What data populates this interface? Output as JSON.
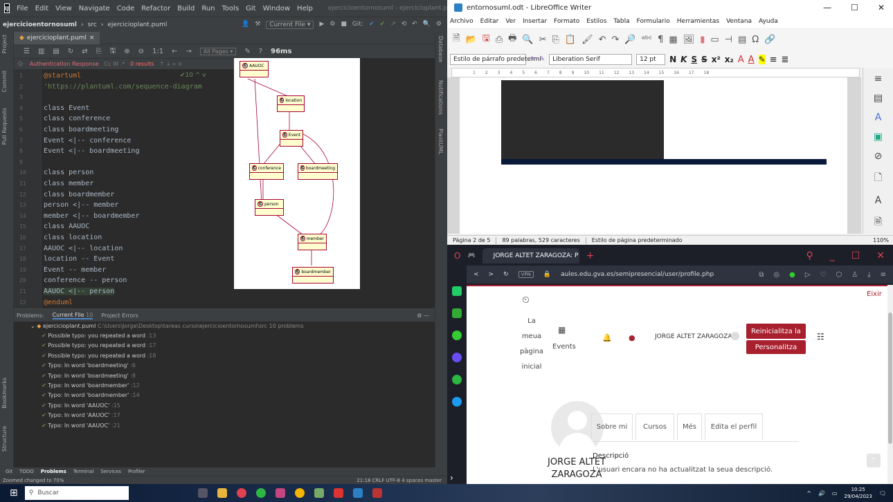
{
  "intellij": {
    "menu": [
      "File",
      "Edit",
      "View",
      "Navigate",
      "Code",
      "Refactor",
      "Build",
      "Run",
      "Tools",
      "Git",
      "Window",
      "Help"
    ],
    "window_title": "ejercicioentornosuml - ejercicioplant.puml",
    "project": "ejercicioentornosuml",
    "src": "src",
    "file": "ejercicioplant.puml",
    "current_file": "Current File ▾",
    "git_label": "Git:",
    "tab": "ejercicioplant.puml",
    "all_pages": "All Pages ▾",
    "zoom_time": "96ms",
    "ratio": "1:1",
    "search_text": "Authentication Response",
    "search_case": "Cc W .*",
    "search_results": "0 results",
    "inspect_count": "✔10 ^ v",
    "code_lines": [
      {
        "n": "1",
        "t": "@startuml",
        "cls": "kw"
      },
      {
        "n": "2",
        "t": "'https://plantuml.com/sequence-diagram",
        "cls": "st"
      },
      {
        "n": "3",
        "t": "",
        "cls": ""
      },
      {
        "n": "4",
        "t": "class Event",
        "cls": ""
      },
      {
        "n": "5",
        "t": "class conference",
        "cls": ""
      },
      {
        "n": "6",
        "t": "class boardmeeting",
        "cls": ""
      },
      {
        "n": "7",
        "t": "Event <|-- conference",
        "cls": ""
      },
      {
        "n": "8",
        "t": "Event <|-- boardmeeting",
        "cls": ""
      },
      {
        "n": "9",
        "t": "",
        "cls": ""
      },
      {
        "n": "10",
        "t": "class person",
        "cls": ""
      },
      {
        "n": "11",
        "t": "class member",
        "cls": ""
      },
      {
        "n": "12",
        "t": "class boardmember",
        "cls": ""
      },
      {
        "n": "13",
        "t": "person <|-- member",
        "cls": ""
      },
      {
        "n": "14",
        "t": "member <|-- boardmember",
        "cls": ""
      },
      {
        "n": "15",
        "t": "class AAUOC",
        "cls": ""
      },
      {
        "n": "16",
        "t": "class location",
        "cls": ""
      },
      {
        "n": "17",
        "t": "AAUOC <|-- location",
        "cls": ""
      },
      {
        "n": "18",
        "t": "location -- Event",
        "cls": ""
      },
      {
        "n": "19",
        "t": "Event -- member",
        "cls": ""
      },
      {
        "n": "20",
        "t": "conference -- person",
        "cls": ""
      },
      {
        "n": "21",
        "t": "AAUOC <|-- person",
        "cls": ""
      },
      {
        "n": "22",
        "t": "@enduml",
        "cls": "kw"
      }
    ],
    "diagram_classes": [
      "AAUOC",
      "location",
      "Event",
      "conference",
      "boardmeeting",
      "person",
      "member",
      "boardmember"
    ],
    "left_strip": [
      "Project",
      "Commit",
      "Pull Requests",
      "Bookmarks",
      "Structure"
    ],
    "right_strip": [
      "Database",
      "Notifications",
      "PlantUML"
    ],
    "problems_tabs": [
      "Problems:",
      "Current File",
      "10",
      "Project Errors"
    ],
    "problems_file": "ejercicioplant.puml",
    "problems_path": "C:\\Users\\Jorge\\Desktop\\tareas curso\\ejercicioentornosuml\\src",
    "problems_count": "10 problems",
    "problems": [
      {
        "t": "Possible typo: you repeated a word",
        "n": ":13"
      },
      {
        "t": "Possible typo: you repeated a word",
        "n": ":17"
      },
      {
        "t": "Possible typo: you repeated a word",
        "n": ":18"
      },
      {
        "t": "Typo: In word 'boardmeeting'",
        "n": ":6"
      },
      {
        "t": "Typo: In word 'boardmeeting'",
        "n": ":8"
      },
      {
        "t": "Typo: In word 'boardmember'",
        "n": ":12"
      },
      {
        "t": "Typo: In word 'boardmember'",
        "n": ":14"
      },
      {
        "t": "Typo: In word 'AAUOC'",
        "n": ":15"
      },
      {
        "t": "Typo: In word 'AAUOC'",
        "n": ":17"
      },
      {
        "t": "Typo: In word 'AAUOC'",
        "n": ":21"
      }
    ],
    "bottom_tabs": [
      "Git",
      "TODO",
      "Problems",
      "Terminal",
      "Services",
      "Profiler"
    ],
    "status_left": "Zoomed changed to 70%",
    "status_right": "21:18  CRLF  UTF-8  4 spaces  master"
  },
  "writer": {
    "title": "entornosuml.odt - LibreOffice Writer",
    "menu": [
      "Archivo",
      "Editar",
      "Ver",
      "Insertar",
      "Formato",
      "Estilos",
      "Tabla",
      "Formulario",
      "Herramientas",
      "Ventana",
      "Ayuda"
    ],
    "para_style": "Estilo de párrafo predetermi",
    "font": "Liberation Serif",
    "size": "12 pt",
    "fmt": [
      "N",
      "K",
      "S",
      "S",
      "x²",
      "x₂"
    ],
    "ruler": [
      "1",
      "2",
      "3",
      "4",
      "5",
      "6",
      "7",
      "8",
      "9",
      "10",
      "11",
      "12",
      "13",
      "14",
      "15",
      "16",
      "17",
      "18"
    ],
    "status_page": "Página 2 de 5",
    "status_words": "89 palabras, 529 caracteres",
    "status_style": "Estilo de página predeterminado",
    "status_zoom": "110%"
  },
  "browser": {
    "tab_title": "JORGE ALTET ZARAGOZA: P",
    "url": "aules.edu.gva.es/semipresencial/user/profile.php",
    "vpn": "VPN",
    "eixir": "Eixir",
    "home_lines": [
      "La",
      "meua",
      "pàgina",
      "inicial"
    ],
    "events": "Events",
    "user_name": "JORGE ALTET ZARAGOZA",
    "btn_reset": "Reinicialitza la",
    "btn_custom": "Personalitza",
    "profile_tabs": [
      "Sobre mi",
      "Cursos",
      "Més",
      "Edita el perfil"
    ],
    "profile_name_1": "JORGE ALTET",
    "profile_name_2": "ZARAGOZA",
    "desc_title": "Descripció",
    "desc_text": "L'usuari encara no ha actualitzat la seua descripció."
  },
  "taskbar": {
    "search": "Buscar",
    "time": "10:25",
    "date": "29/04/2023"
  }
}
